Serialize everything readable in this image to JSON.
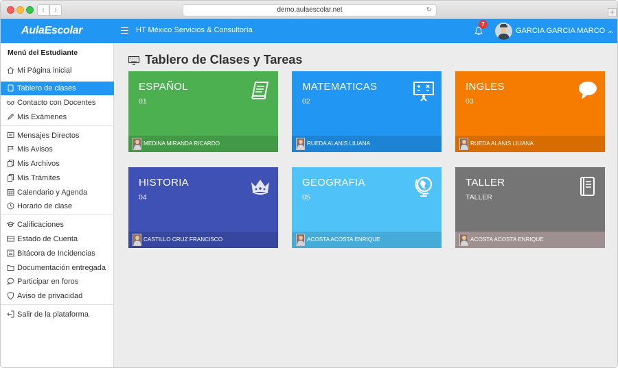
{
  "browser": {
    "url": "demo.aulaescolar.net"
  },
  "header": {
    "logo": "AulaEscolar",
    "organization": "HT México Servicios & Consultoría",
    "notifications_count": "7",
    "user_name": "GARCIA GARCIA MARCO ..."
  },
  "sidebar": {
    "title": "Menú del Estudiante",
    "items": [
      {
        "label": "Mi Página inicial",
        "icon": "home-icon"
      },
      {
        "label": "Tablero de clases",
        "icon": "tablet-icon",
        "active": true
      },
      {
        "label": "Contacto con Docentes",
        "icon": "glasses-icon"
      },
      {
        "label": "Mis Exámenes",
        "icon": "pencil-icon"
      },
      {
        "label": "Mensajes Directos",
        "icon": "message-icon"
      },
      {
        "label": "Mis Avisos",
        "icon": "flag-icon"
      },
      {
        "label": "Mis Archivos",
        "icon": "files-icon"
      },
      {
        "label": "Mis Trámites",
        "icon": "documents-icon"
      },
      {
        "label": "Calendario y Agenda",
        "icon": "calendar-icon"
      },
      {
        "label": "Horario de clase",
        "icon": "clock-icon"
      },
      {
        "label": "Calificaciones",
        "icon": "graduation-cap-icon"
      },
      {
        "label": "Estado de Cuenta",
        "icon": "credit-card-icon"
      },
      {
        "label": "Bitácora de Incidencias",
        "icon": "list-icon"
      },
      {
        "label": "Documentación entregada",
        "icon": "folder-icon"
      },
      {
        "label": "Participar en foros",
        "icon": "chat-icon"
      },
      {
        "label": "Aviso de privacidad",
        "icon": "shield-icon"
      },
      {
        "label": "Salir de la plataforma",
        "icon": "logout-icon"
      }
    ]
  },
  "main": {
    "title": "Tablero de Clases y Tareas",
    "classes": [
      {
        "name": "ESPAÑOL",
        "code": "01",
        "teacher": "MEDINA MIRANDA RICARDO",
        "color": "#4caf50",
        "icon": "scroll-icon"
      },
      {
        "name": "MATEMATICAS",
        "code": "02",
        "teacher": "RUEDA ALANIS LILIANA",
        "color": "#2196f3",
        "icon": "blackboard-icon"
      },
      {
        "name": "INGLES",
        "code": "03",
        "teacher": "RUEDA ALANIS LILIANA",
        "color": "#f57c00",
        "icon": "speech-bubble-icon"
      },
      {
        "name": "HISTORIA",
        "code": "04",
        "teacher": "CASTILLO CRUZ FRANCISCO",
        "color": "#3f51b5",
        "icon": "crown-icon"
      },
      {
        "name": "GEOGRAFIA",
        "code": "05",
        "teacher": "ACOSTA ACOSTA ENRIQUE",
        "color": "#4fc3f7",
        "icon": "globe-icon"
      },
      {
        "name": "TALLER",
        "code": "TALLER",
        "teacher": "ACOSTA ACOSTA ENRIQUE",
        "color": "#757575",
        "icon": "book-icon"
      }
    ]
  }
}
